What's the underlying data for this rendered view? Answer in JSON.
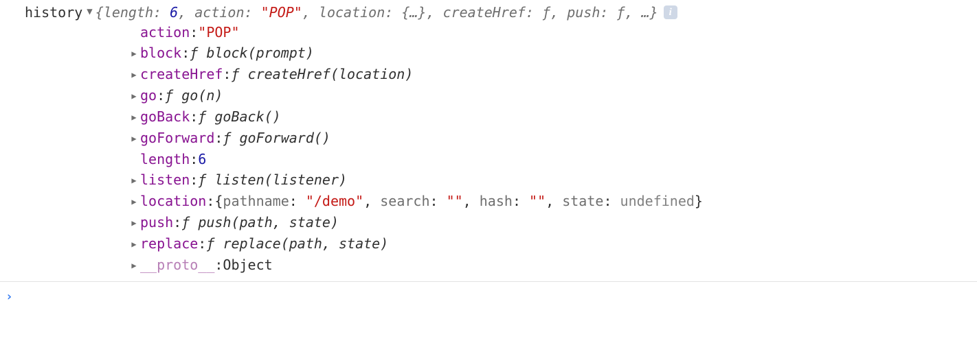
{
  "variable_name": "history",
  "summary": {
    "open": "{",
    "length_key": "length",
    "length_val": "6",
    "action_key": "action",
    "action_val": "\"POP\"",
    "location_key": "location",
    "location_val": "{…}",
    "createHref_key": "createHref",
    "createHref_val": "ƒ",
    "push_key": "push",
    "push_val": "ƒ",
    "ellipsis": "…",
    "close": "}"
  },
  "props": {
    "action": {
      "key": "action",
      "val": "\"POP\""
    },
    "block": {
      "key": "block",
      "sig": "block(prompt)"
    },
    "createHref": {
      "key": "createHref",
      "sig": "createHref(location)"
    },
    "go": {
      "key": "go",
      "sig": "go(n)"
    },
    "goBack": {
      "key": "goBack",
      "sig": "goBack()"
    },
    "goForward": {
      "key": "goForward",
      "sig": "goForward()"
    },
    "length": {
      "key": "length",
      "val": "6"
    },
    "listen": {
      "key": "listen",
      "sig": "listen(listener)"
    },
    "location": {
      "key": "location",
      "pathname_k": "pathname",
      "pathname_v": "\"/demo\"",
      "search_k": "search",
      "search_v": "\"\"",
      "hash_k": "hash",
      "hash_v": "\"\"",
      "state_k": "state",
      "state_v": "undefined"
    },
    "push": {
      "key": "push",
      "sig": "push(path, state)"
    },
    "replace": {
      "key": "replace",
      "sig": "replace(path, state)"
    },
    "proto": {
      "key": "__proto__",
      "val": "Object"
    }
  },
  "fn_glyph": "ƒ",
  "info_glyph": "i",
  "prompt_glyph": "›"
}
